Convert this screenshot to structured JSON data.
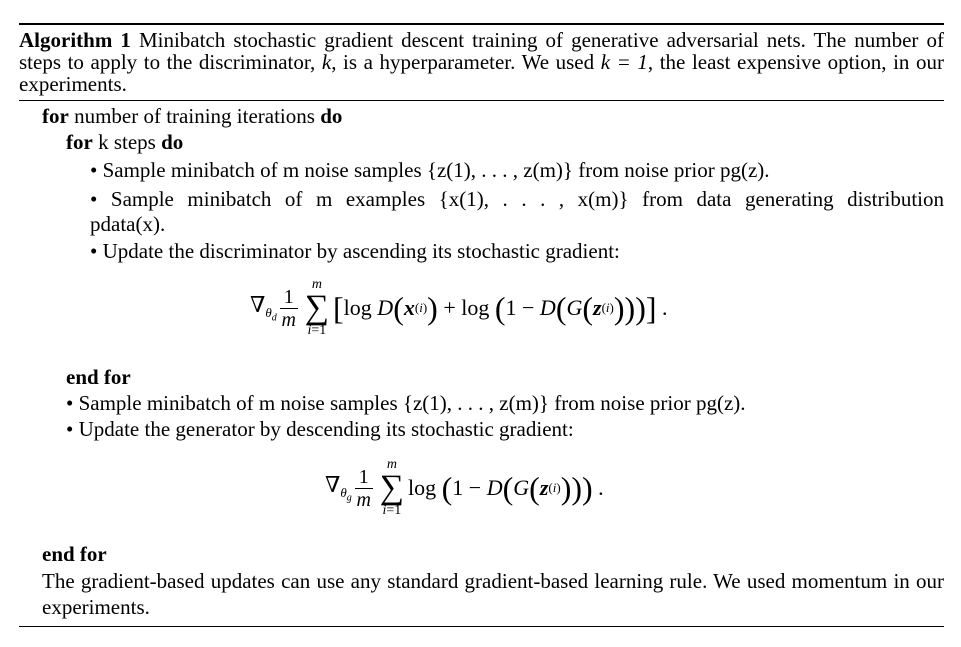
{
  "algorithm": {
    "label": "Algorithm 1",
    "caption": "Minibatch stochastic gradient descent training of generative adversarial nets. The number of steps to apply to the discriminator, k, is a hyperparameter. We used k = 1, the least expensive option, in our experiments.",
    "caption_parts": {
      "a": "Minibatch stochastic gradient descent training of generative adversarial nets. The number of steps to apply to the discriminator, ",
      "k": "k",
      "b": ", is a hyperparameter. We used ",
      "eq": "k = 1",
      "c": ", the least expensive option, in our experiments."
    },
    "lines": {
      "outer_for_kw": "for",
      "outer_for_text": " number of training iterations ",
      "do": "do",
      "inner_for_kw": "for",
      "inner_for_text": " k steps ",
      "d1": "• Sample minibatch of m noise samples {z(1), . . . , z(m)} from noise prior pg(z).",
      "d2": "• Sample minibatch of m examples {x(1), . . . , x(m)} from data generating distribution",
      "d2b": "pdata(x).",
      "d3": "• Update the discriminator by ascending its stochastic gradient:",
      "end_for_inner": "end for",
      "g1": "• Sample minibatch of m noise samples {z(1), . . . , z(m)} from noise prior pg(z).",
      "g2": "• Update the generator by descending its stochastic gradient:",
      "end_for_outer": "end for",
      "footer": "The gradient-based updates can use any standard gradient-based learning rule. We used momentum in our experiments."
    },
    "equations": {
      "discriminator": "∇θd (1/m) Σ_{i=1}^{m} [log D(x(i)) + log(1 − D(G(z(i))))].",
      "generator": "∇θg (1/m) Σ_{i=1}^{m} log(1 − D(G(z(i))))."
    }
  }
}
